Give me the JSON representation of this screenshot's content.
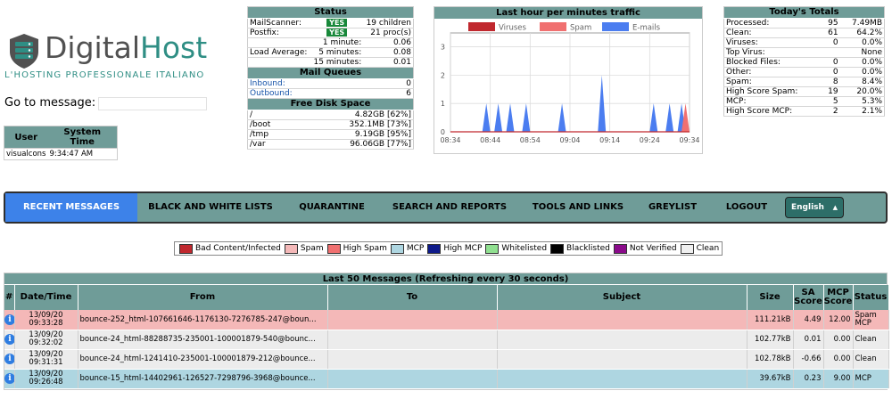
{
  "logo": {
    "name_part1": "Digital",
    "name_part2": "Host",
    "tagline": "L'HOSTING PROFESSIONALE ITALIANO"
  },
  "goto": {
    "label": "Go to message:",
    "value": ""
  },
  "user_box": {
    "col_user": "User",
    "col_time": "System Time",
    "user": "visualcons",
    "time": "9:34:47 AM"
  },
  "status": {
    "title": "Status",
    "mailscanner_label": "MailScanner:",
    "mailscanner_state": "YES",
    "mailscanner_value": "19 children",
    "postfix_label": "Postfix:",
    "postfix_state": "YES",
    "postfix_value": "21 proc(s)",
    "load_label": "Load Average:",
    "load": [
      {
        "label": "1 minute:",
        "value": "0.06"
      },
      {
        "label": "5 minutes:",
        "value": "0.08"
      },
      {
        "label": "15 minutes:",
        "value": "0.01"
      }
    ],
    "queues_title": "Mail Queues",
    "inbound_label": "Inbound:",
    "inbound_value": "0",
    "outbound_label": "Outbound:",
    "outbound_value": "6",
    "disk_title": "Free Disk Space",
    "disks": [
      {
        "mount": "/",
        "free": "4.82GB [62%]"
      },
      {
        "mount": "/boot",
        "free": "352.1MB [73%]"
      },
      {
        "mount": "/tmp",
        "free": "9.19GB [95%]"
      },
      {
        "mount": "/var",
        "free": "96.06GB [77%]"
      }
    ]
  },
  "chart": {
    "title": "Last hour per minutes traffic",
    "colors": {
      "viruses": "#c0282e",
      "spam": "#f07070",
      "emails": "#4b7df0"
    }
  },
  "chart_data": {
    "type": "area",
    "title": "Last hour per minutes traffic",
    "xlabel": "",
    "ylabel": "",
    "x_ticks": [
      "08:34",
      "08:44",
      "08:54",
      "09:04",
      "09:14",
      "09:24",
      "09:34"
    ],
    "ylim": [
      0,
      3.3
    ],
    "y_ticks": [
      0,
      1,
      2,
      3
    ],
    "grid": true,
    "legend": "top",
    "series": [
      {
        "name": "Viruses",
        "values": [
          [
            0,
            0
          ],
          [
            60,
            0
          ]
        ]
      },
      {
        "name": "Spam",
        "values": [
          [
            0,
            0
          ],
          [
            58,
            0
          ],
          [
            59,
            1
          ],
          [
            60,
            0
          ]
        ]
      },
      {
        "name": "E-mails",
        "values": [
          [
            0,
            0
          ],
          [
            8,
            0
          ],
          [
            9,
            1
          ],
          [
            10,
            0
          ],
          [
            11,
            0
          ],
          [
            12,
            1
          ],
          [
            13,
            0
          ],
          [
            14,
            0
          ],
          [
            15,
            1
          ],
          [
            16,
            0
          ],
          [
            18,
            0
          ],
          [
            19,
            1
          ],
          [
            20,
            0
          ],
          [
            27,
            0
          ],
          [
            28,
            1
          ],
          [
            29,
            0
          ],
          [
            37,
            0
          ],
          [
            38,
            2
          ],
          [
            39,
            0
          ],
          [
            50,
            0
          ],
          [
            51,
            1
          ],
          [
            52,
            0
          ],
          [
            54,
            0
          ],
          [
            55,
            1
          ],
          [
            56,
            0
          ],
          [
            57,
            0
          ],
          [
            58,
            1
          ],
          [
            59,
            0
          ],
          [
            60,
            0
          ]
        ]
      }
    ]
  },
  "totals": {
    "title": "Today's Totals",
    "rows": [
      {
        "label": "Processed:",
        "count": "95",
        "value": "7.49MB"
      },
      {
        "label": "Clean:",
        "count": "61",
        "value": "64.2%"
      },
      {
        "label": "Viruses:",
        "count": "0",
        "value": "0.0%"
      },
      {
        "label": "Top Virus:",
        "count": "",
        "value": "None"
      },
      {
        "label": "Blocked Files:",
        "count": "0",
        "value": "0.0%"
      },
      {
        "label": "Other:",
        "count": "0",
        "value": "0.0%"
      },
      {
        "label": "Spam:",
        "count": "8",
        "value": "8.4%"
      },
      {
        "label": "High Score Spam:",
        "count": "19",
        "value": "20.0%"
      },
      {
        "label": "MCP:",
        "count": "5",
        "value": "5.3%"
      },
      {
        "label": "High Score MCP:",
        "count": "2",
        "value": "2.1%"
      }
    ]
  },
  "nav": {
    "items": [
      "RECENT MESSAGES",
      "BLACK AND WHITE LISTS",
      "QUARANTINE",
      "SEARCH AND REPORTS",
      "TOOLS AND LINKS",
      "GREYLIST",
      "LOGOUT"
    ],
    "language": "English"
  },
  "legend": [
    {
      "label": "Bad Content/Infected",
      "color": "#c0282e"
    },
    {
      "label": "Spam",
      "color": "#f4b8b8"
    },
    {
      "label": "High Spam",
      "color": "#f07070"
    },
    {
      "label": "MCP",
      "color": "#aed6e1"
    },
    {
      "label": "High MCP",
      "color": "#0e1a8a"
    },
    {
      "label": "Whitelisted",
      "color": "#90e090"
    },
    {
      "label": "Blacklisted",
      "color": "#000000"
    },
    {
      "label": "Not Verified",
      "color": "#8a0a8a"
    },
    {
      "label": "Clean",
      "color": "#efefef"
    }
  ],
  "messages": {
    "title": "Last 50 Messages (Refreshing every 30 seconds)",
    "columns": [
      "#",
      "Date/Time",
      "From",
      "To",
      "Subject",
      "Size",
      "SA Score",
      "MCP Score",
      "Status"
    ],
    "rows": [
      {
        "date": "13/09/20",
        "time": "09:33:28",
        "from": "bounce-252_html-107661646-1176130-7276785-247@boun...",
        "to": "",
        "subject": "",
        "size": "111.21kB",
        "sa": "4.49",
        "mcp": "12.00",
        "status1": "Spam",
        "status2": "MCP",
        "kind": "spam"
      },
      {
        "date": "13/09/20",
        "time": "09:32:02",
        "from": "bounce-24_html-88288735-235001-100001879-540@bounc...",
        "to": "",
        "subject": "",
        "size": "102.77kB",
        "sa": "0.01",
        "mcp": "0.00",
        "status1": "Clean",
        "status2": "",
        "kind": "clean"
      },
      {
        "date": "13/09/20",
        "time": "09:31:31",
        "from": "bounce-24_html-1241410-235001-100001879-212@bounce...",
        "to": "",
        "subject": "",
        "size": "102.78kB",
        "sa": "-0.66",
        "mcp": "0.00",
        "status1": "Clean",
        "status2": "",
        "kind": "clean"
      },
      {
        "date": "13/09/20",
        "time": "09:26:48",
        "from": "bounce-15_html-14402961-126527-7298796-3968@bounce...",
        "to": "",
        "subject": "",
        "size": "39.67kB",
        "sa": "0.23",
        "mcp": "9.00",
        "status1": "MCP",
        "status2": "",
        "kind": "mcp"
      }
    ]
  }
}
